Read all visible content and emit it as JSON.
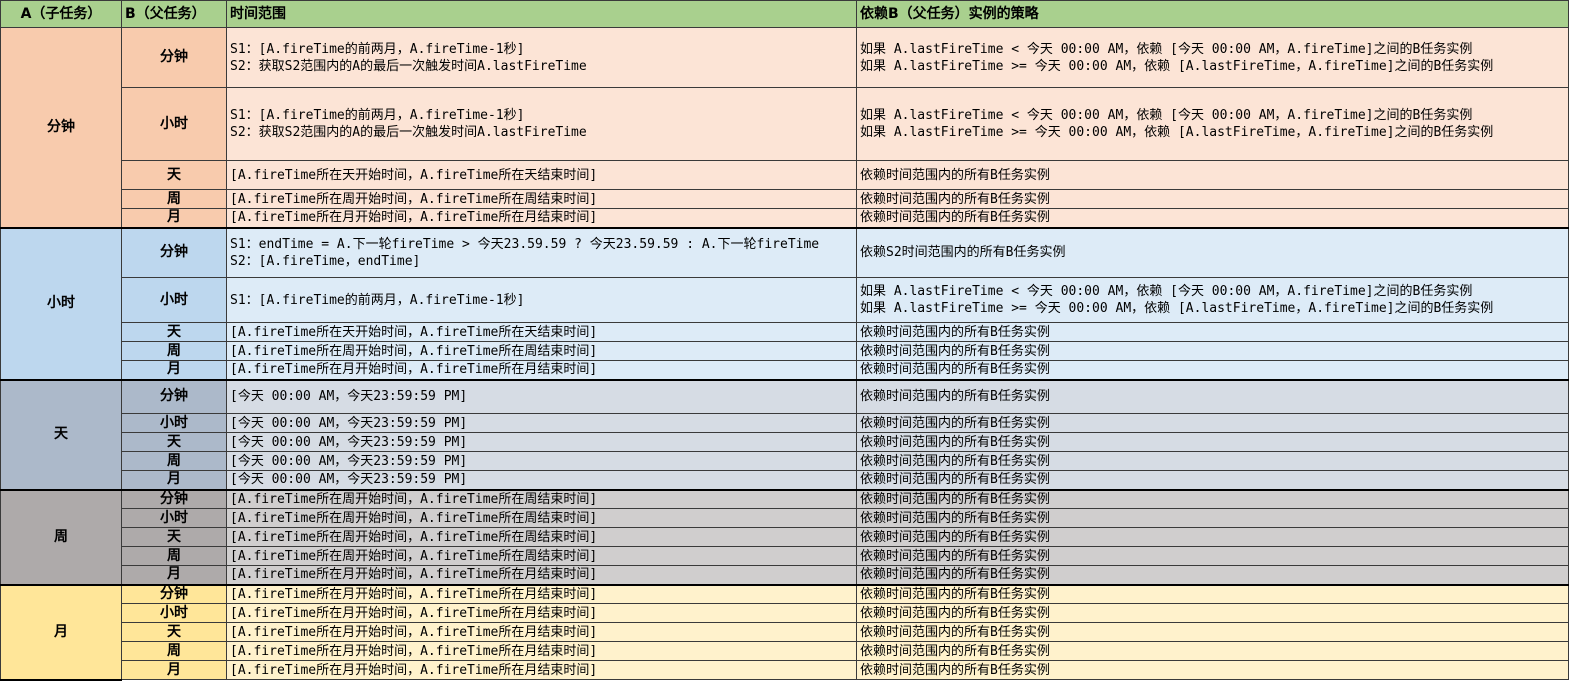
{
  "headers": [
    "A（子任务）",
    "B（父任务）",
    "时间范围",
    "依赖B（父任务）实例的策略"
  ],
  "groups": [
    {
      "a": "分钟",
      "rows": [
        {
          "b": "分钟",
          "range": "S1：[A.fireTime的前两月，A.fireTime-1秒]\nS2：获取S2范围内的A的最后一次触发时间A.lastFireTime",
          "strategy": "如果 A.lastFireTime < 今天 00:00 AM，依赖 [今天 00:00 AM，A.fireTime]之间的B任务实例\n如果 A.lastFireTime >= 今天 00:00 AM，依赖 [A.lastFireTime，A.fireTime]之间的B任务实例"
        },
        {
          "b": "小时",
          "range": "S1：[A.fireTime的前两月，A.fireTime-1秒]\nS2：获取S2范围内的A的最后一次触发时间A.lastFireTime",
          "strategy": "如果 A.lastFireTime < 今天 00:00 AM，依赖 [今天 00:00 AM，A.fireTime]之间的B任务实例\n如果 A.lastFireTime >= 今天 00:00 AM，依赖 [A.lastFireTime，A.fireTime]之间的B任务实例"
        },
        {
          "b": "天",
          "range": "[A.fireTime所在天开始时间，A.fireTime所在天结束时间]",
          "strategy": "依赖时间范围内的所有B任务实例"
        },
        {
          "b": "周",
          "range": "[A.fireTime所在周开始时间，A.fireTime所在周结束时间]",
          "strategy": "依赖时间范围内的所有B任务实例"
        },
        {
          "b": "月",
          "range": "[A.fireTime所在月开始时间，A.fireTime所在月结束时间]",
          "strategy": "依赖时间范围内的所有B任务实例"
        }
      ]
    },
    {
      "a": "小时",
      "rows": [
        {
          "b": "分钟",
          "range": "S1：endTime = A.下一轮fireTime > 今天23.59.59 ? 今天23.59.59 : A.下一轮fireTime\nS2：[A.fireTime，endTime]",
          "strategy": "依赖S2时间范围内的所有B任务实例"
        },
        {
          "b": "小时",
          "range": "S1：[A.fireTime的前两月，A.fireTime-1秒]",
          "strategy": "如果 A.lastFireTime < 今天 00:00 AM，依赖 [今天 00:00 AM，A.fireTime]之间的B任务实例\n如果 A.lastFireTime >= 今天 00:00 AM，依赖 [A.lastFireTime，A.fireTime]之间的B任务实例"
        },
        {
          "b": "天",
          "range": "[A.fireTime所在天开始时间，A.fireTime所在天结束时间]",
          "strategy": "依赖时间范围内的所有B任务实例"
        },
        {
          "b": "周",
          "range": "[A.fireTime所在周开始时间，A.fireTime所在周结束时间]",
          "strategy": "依赖时间范围内的所有B任务实例"
        },
        {
          "b": "月",
          "range": "[A.fireTime所在月开始时间，A.fireTime所在月结束时间]",
          "strategy": "依赖时间范围内的所有B任务实例"
        }
      ]
    },
    {
      "a": "天",
      "rows": [
        {
          "b": "分钟",
          "range": "[今天 00:00 AM，今天23:59:59 PM]",
          "strategy": "依赖时间范围内的所有B任务实例"
        },
        {
          "b": "小时",
          "range": "[今天 00:00 AM，今天23:59:59 PM]",
          "strategy": "依赖时间范围内的所有B任务实例"
        },
        {
          "b": "天",
          "range": "[今天 00:00 AM，今天23:59:59 PM]",
          "strategy": "依赖时间范围内的所有B任务实例"
        },
        {
          "b": "周",
          "range": "[今天 00:00 AM，今天23:59:59 PM]",
          "strategy": "依赖时间范围内的所有B任务实例"
        },
        {
          "b": "月",
          "range": "[今天 00:00 AM，今天23:59:59 PM]",
          "strategy": "依赖时间范围内的所有B任务实例"
        }
      ]
    },
    {
      "a": "周",
      "rows": [
        {
          "b": "分钟",
          "range": "[A.fireTime所在周开始时间，A.fireTime所在周结束时间]",
          "strategy": "依赖时间范围内的所有B任务实例"
        },
        {
          "b": "小时",
          "range": "[A.fireTime所在周开始时间，A.fireTime所在周结束时间]",
          "strategy": "依赖时间范围内的所有B任务实例"
        },
        {
          "b": "天",
          "range": "[A.fireTime所在周开始时间，A.fireTime所在周结束时间]",
          "strategy": "依赖时间范围内的所有B任务实例"
        },
        {
          "b": "周",
          "range": "[A.fireTime所在周开始时间，A.fireTime所在周结束时间]",
          "strategy": "依赖时间范围内的所有B任务实例"
        },
        {
          "b": "月",
          "range": "[A.fireTime所在月开始时间，A.fireTime所在月结束时间]",
          "strategy": "依赖时间范围内的所有B任务实例"
        }
      ]
    },
    {
      "a": "月",
      "rows": [
        {
          "b": "分钟",
          "range": "[A.fireTime所在月开始时间，A.fireTime所在月结束时间]",
          "strategy": "依赖时间范围内的所有B任务实例"
        },
        {
          "b": "小时",
          "range": "[A.fireTime所在月开始时间，A.fireTime所在月结束时间]",
          "strategy": "依赖时间范围内的所有B任务实例"
        },
        {
          "b": "天",
          "range": "[A.fireTime所在月开始时间，A.fireTime所在月结束时间]",
          "strategy": "依赖时间范围内的所有B任务实例"
        },
        {
          "b": "周",
          "range": "[A.fireTime所在月开始时间，A.fireTime所在月结束时间]",
          "strategy": "依赖时间范围内的所有B任务实例"
        },
        {
          "b": "月",
          "range": "[A.fireTime所在月开始时间，A.fireTime所在月结束时间]",
          "strategy": "依赖时间范围内的所有B任务实例"
        }
      ]
    }
  ]
}
